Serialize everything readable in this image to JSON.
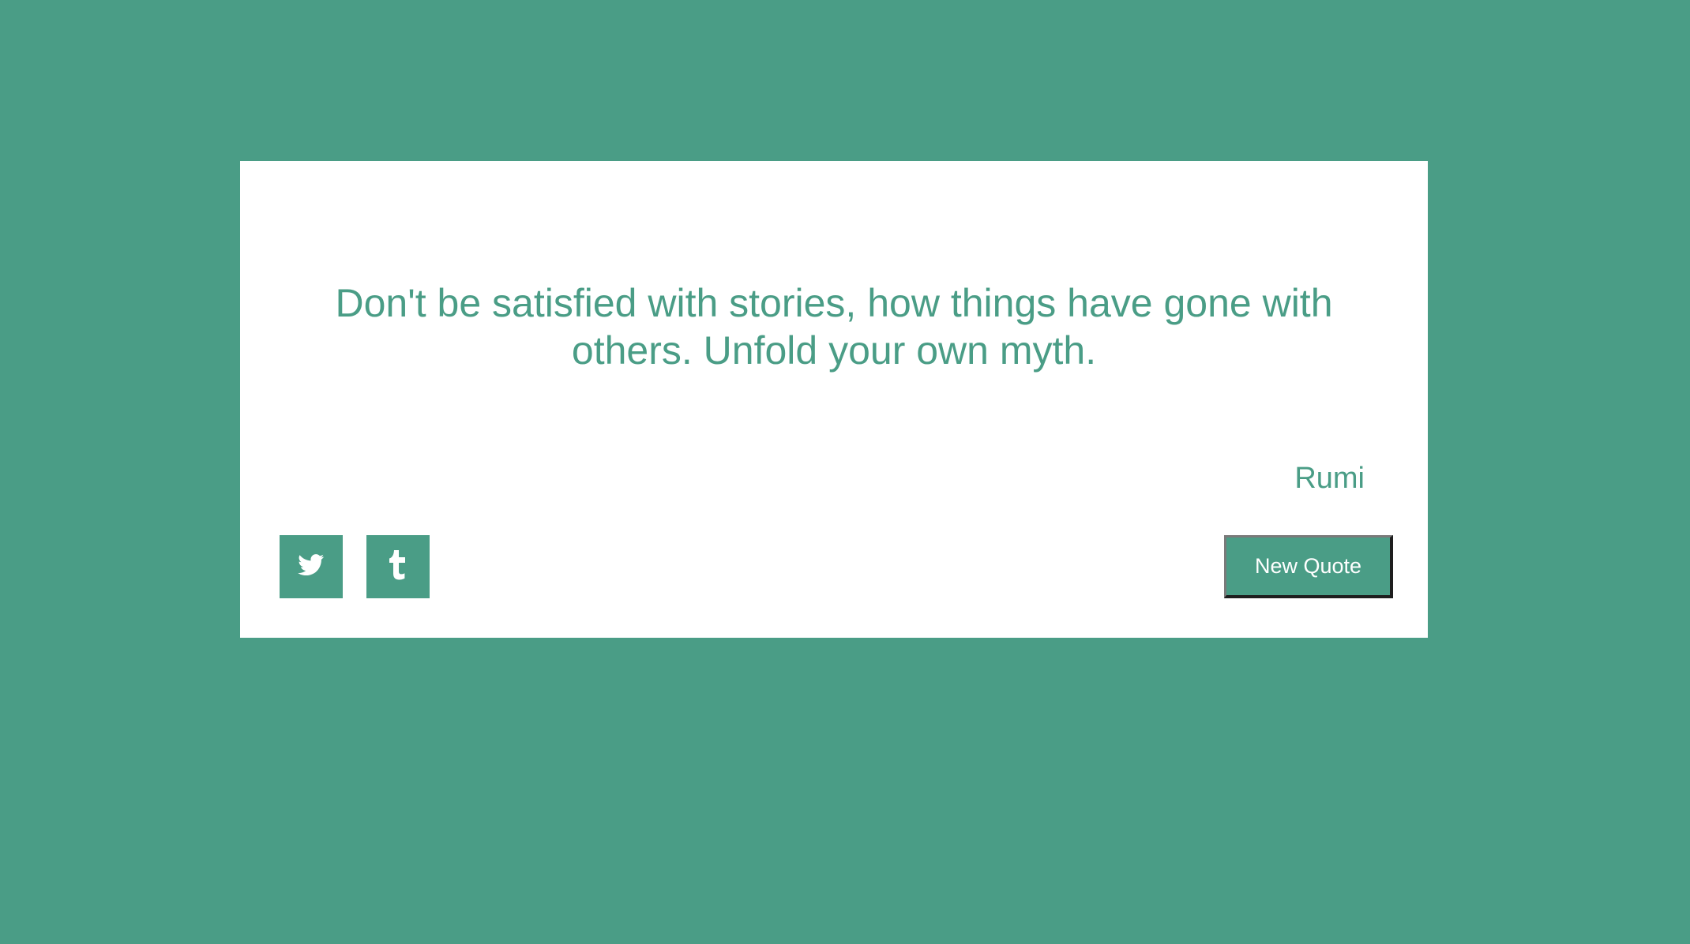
{
  "quote": {
    "text": "Don't be satisfied with stories, how things have gone with others. Unfold your own myth.",
    "author": "Rumi"
  },
  "actions": {
    "twitter_icon": "twitter-bird-icon",
    "tumblr_icon": "tumblr-t-icon",
    "new_quote_label": "New Quote"
  },
  "colors": {
    "background": "#4a9d86",
    "card": "#ffffff",
    "accent": "#4a9d86"
  }
}
